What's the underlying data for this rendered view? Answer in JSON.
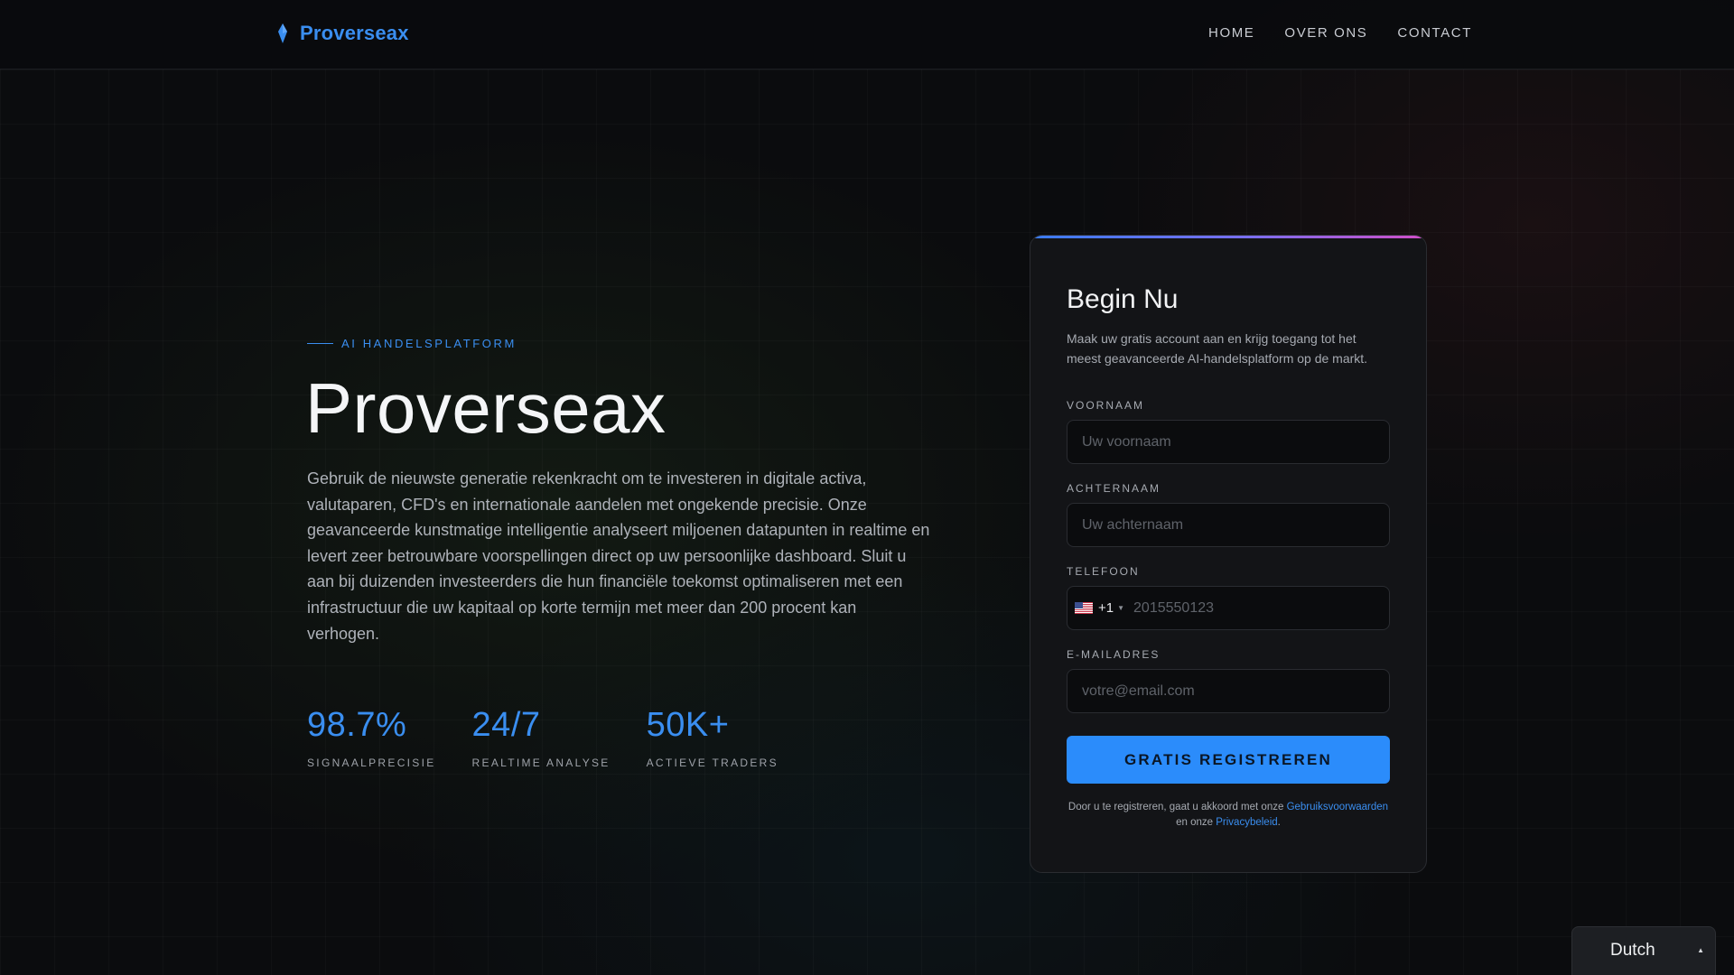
{
  "header": {
    "brand": "Proverseax",
    "nav": [
      {
        "label": "HOME"
      },
      {
        "label": "OVER ONS"
      },
      {
        "label": "CONTACT"
      }
    ]
  },
  "hero": {
    "eyebrow": "AI HANDELSPLATFORM",
    "title": "Proverseax",
    "description": "Gebruik de nieuwste generatie rekenkracht om te investeren in digitale activa, valutaparen, CFD's en internationale aandelen met ongekende precisie. Onze geavanceerde kunstmatige intelligentie analyseert miljoenen datapunten in realtime en levert zeer betrouwbare voorspellingen direct op uw persoonlijke dashboard. Sluit u aan bij duizenden investeerders die hun financiële toekomst optimaliseren met een infrastructuur die uw kapitaal op korte termijn met meer dan 200 procent kan verhogen.",
    "stats": [
      {
        "value": "98.7%",
        "label": "SIGNAALPRECISIE"
      },
      {
        "value": "24/7",
        "label": "REALTIME ANALYSE"
      },
      {
        "value": "50K+",
        "label": "ACTIEVE TRADERS"
      }
    ]
  },
  "form": {
    "title": "Begin Nu",
    "subtitle": "Maak uw gratis account aan en krijg toegang tot het meest geavanceerde AI-handelsplatform op de markt.",
    "first_name": {
      "label": "VOORNAAM",
      "placeholder": "Uw voornaam",
      "value": ""
    },
    "last_name": {
      "label": "ACHTERNAAM",
      "placeholder": "Uw achternaam",
      "value": ""
    },
    "phone": {
      "label": "TELEFOON",
      "dial_code": "+1",
      "country_flag": "us-flag-icon",
      "placeholder": "2015550123",
      "value": ""
    },
    "email": {
      "label": "E-MAILADRES",
      "placeholder": "votre@email.com",
      "value": ""
    },
    "submit_label": "GRATIS REGISTREREN",
    "terms": {
      "prefix": "Door u te registreren, gaat u akkoord met onze ",
      "terms_link": "Gebruiksvoorwaarden",
      "middle": " en onze ",
      "privacy_link": "Privacybeleid",
      "suffix": "."
    }
  },
  "language": {
    "selected": "Dutch"
  },
  "colors": {
    "accent": "#3a8ef0",
    "button": "#2b8cfb",
    "background": "#0b0c0e",
    "card": "#131417",
    "gradient_start": "#3a7cf0",
    "gradient_end": "#d14ec8"
  },
  "icons": {
    "brand": "gem-drop-icon",
    "phone_caret": "caret-down-icon",
    "language_caret": "caret-up-icon"
  }
}
